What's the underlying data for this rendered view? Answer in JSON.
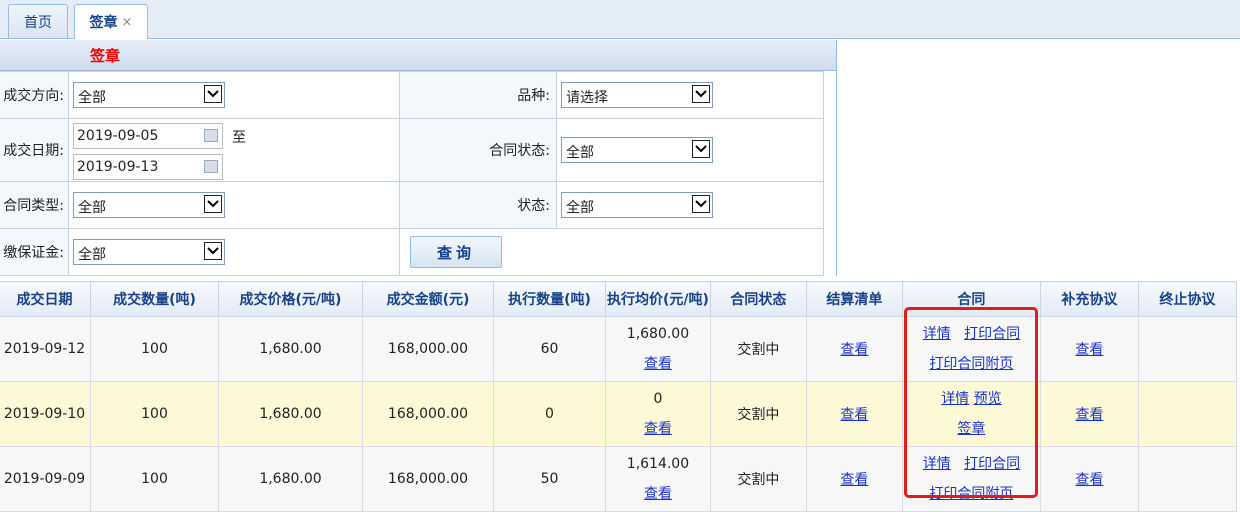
{
  "tabs": [
    {
      "label": "首页"
    },
    {
      "label": "签章",
      "close": "×"
    }
  ],
  "panel": {
    "title": "签章"
  },
  "form": {
    "direction": {
      "label": "成交方向:",
      "value": "全部"
    },
    "variety": {
      "label": "品种:",
      "value": "请选择"
    },
    "date": {
      "label": "成交日期:",
      "from": "2019-09-05",
      "to": "2019-09-13",
      "sep": "至"
    },
    "contract_status": {
      "label": "合同状态:",
      "value": "全部"
    },
    "contract_type": {
      "label": "合同类型:",
      "value": "全部"
    },
    "status": {
      "label": "状态:",
      "value": "全部"
    },
    "deposit": {
      "label": "缴保证金:",
      "value": "全部"
    },
    "query_label": "查询"
  },
  "grid": {
    "columns": [
      "成交日期",
      "成交数量(吨)",
      "成交价格(元/吨)",
      "成交金额(元)",
      "执行数量(吨)",
      "执行均价(元/吨)",
      "合同状态",
      "结算清单",
      "合同",
      "补充协议",
      "终止协议"
    ],
    "rows": [
      {
        "date": "2019-09-12",
        "qty": "100",
        "price": "1,680.00",
        "amount": "168,000.00",
        "exec_qty": "60",
        "exec_price": "1,680.00",
        "exec_link": "查看",
        "status": "交割中",
        "settle": "查看",
        "c1": "详情",
        "c2": "打印合同",
        "c3": "打印合同附页",
        "supp": "查看",
        "term": ""
      },
      {
        "date": "2019-09-10",
        "qty": "100",
        "price": "1,680.00",
        "amount": "168,000.00",
        "exec_qty": "0",
        "exec_price": "0",
        "exec_link": "查看",
        "status": "交割中",
        "settle": "查看",
        "c1": "详情",
        "c2": "预览",
        "c3": "签章",
        "supp": "查看",
        "term": ""
      },
      {
        "date": "2019-09-09",
        "qty": "100",
        "price": "1,680.00",
        "amount": "168,000.00",
        "exec_qty": "50",
        "exec_price": "1,614.00",
        "exec_link": "查看",
        "status": "交割中",
        "settle": "查看",
        "c1": "详情",
        "c2": "打印合同",
        "c3": "打印合同附页",
        "supp": "查看",
        "term": ""
      }
    ]
  },
  "colors": {
    "accent": "#15428b",
    "highlight": "#e21b1b",
    "link": "#1b33c9"
  }
}
